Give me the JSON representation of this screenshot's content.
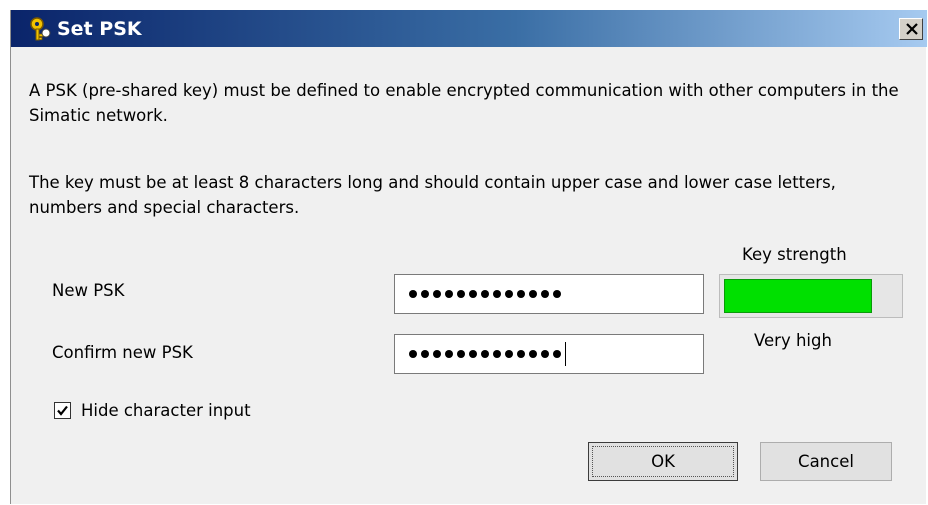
{
  "window": {
    "title": "Set PSK",
    "icon": "key-shield-icon",
    "title_gradient": [
      "#0a246a",
      "#a6caf0"
    ]
  },
  "intro_text": "A PSK (pre-shared key) must be defined to enable encrypted communication with other computers in the Simatic network.",
  "requirement_text": "The key must be at least 8 characters long and should contain upper case and lower case letters, numbers and special characters.",
  "fields": {
    "new_psk": {
      "label": "New PSK",
      "masked_length": 13
    },
    "confirm_psk": {
      "label": "Confirm new PSK",
      "masked_length": 13,
      "focused": true
    }
  },
  "strength": {
    "label": "Key strength",
    "value_text": "Very high",
    "level": 0.85,
    "color": "#00e000"
  },
  "hide_input": {
    "label": "Hide character input",
    "checked": true
  },
  "buttons": {
    "ok": "OK",
    "cancel": "Cancel"
  }
}
